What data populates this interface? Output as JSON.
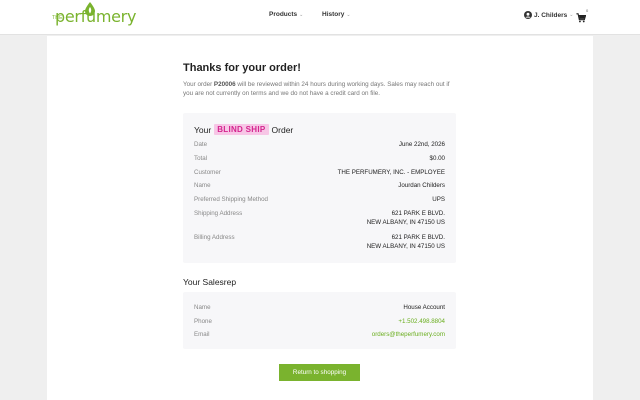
{
  "header": {
    "logo": {
      "prefix": "THE",
      "word": "perfumery"
    },
    "nav": [
      {
        "label": "Products"
      },
      {
        "label": "History"
      }
    ],
    "user_label": "J. Childers",
    "cart_count": "0"
  },
  "confirmation": {
    "title": "Thanks for your order!",
    "intro_pre": "Your order ",
    "order_id": "P20006",
    "intro_post": " will be reviewed within 24 hours during working days. Sales may reach out if you are not currently on terms and we do not have a credit card on file."
  },
  "order": {
    "title_pre": "Your",
    "badge": "BLIND SHIP",
    "title_post": "Order",
    "rows": [
      {
        "label": "Date",
        "value": "June 22nd, 2026"
      },
      {
        "label": "Total",
        "value": "$0.00"
      },
      {
        "label": "Customer",
        "value": "THE PERFUMERY, INC. - EMPLOYEE"
      },
      {
        "label": "Name",
        "value": "Jourdan Childers"
      },
      {
        "label": "Preferred Shipping Method",
        "value": "UPS"
      },
      {
        "label": "Shipping Address",
        "line1": "621 PARK E BLVD.",
        "line2": "NEW ALBANY, IN 47150 US"
      },
      {
        "label": "Billing Address",
        "line1": "621 PARK E BLVD.",
        "line2": "NEW ALBANY, IN 47150 US"
      }
    ]
  },
  "salesrep": {
    "title": "Your Salesrep",
    "rows": [
      {
        "label": "Name",
        "value": "House Account"
      },
      {
        "label": "Phone",
        "value": "+1.502.498.8804"
      },
      {
        "label": "Email",
        "value": "orders@theperfumery.com"
      }
    ]
  },
  "actions": {
    "return_label": "Return to shopping"
  },
  "colors": {
    "brand_green": "#7ab32e",
    "blind_ship_bg": "#f7c6e6",
    "blind_ship_text": "#d4258f"
  },
  "icons": [
    "leaf-drop-logo-icon",
    "chevron-down-icon",
    "user-circle-icon",
    "cart-icon"
  ]
}
